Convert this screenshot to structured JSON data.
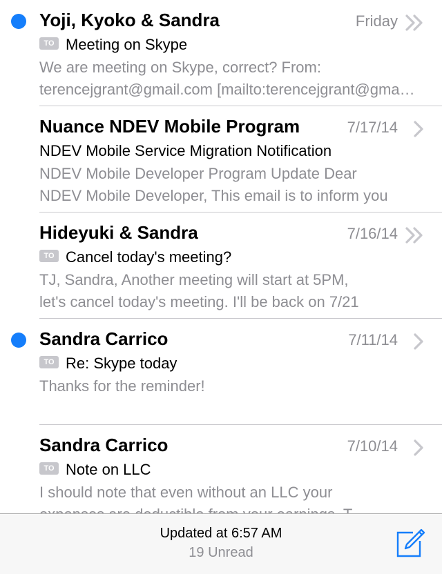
{
  "colors": {
    "unread_dot": "#157efb",
    "secondary_text": "#8e8e93",
    "to_badge": "#c7c7cc",
    "toolbar_bg": "#f7f7f7",
    "accent": "#157efb"
  },
  "messages": [
    {
      "sender": "Yoji, Kyoko & Sandra",
      "date": "Friday",
      "unread": true,
      "to_badge": "TO",
      "subject": "Meeting on Skype",
      "preview_line1": "We are meeting on Skype, correct? From:",
      "preview_line2": "terencejgrant@gmail.com [mailto:terencejgrant@gmail.com]",
      "thread_icon": "double-chevron-icon"
    },
    {
      "sender": "Nuance NDEV Mobile Program",
      "date": "7/17/14",
      "unread": false,
      "to_badge": "",
      "subject": "NDEV Mobile Service Migration Notification",
      "preview_line1": "NDEV Mobile Developer Program Update Dear",
      "preview_line2": "NDEV Mobile Developer, This email is to inform you",
      "thread_icon": "chevron-right-icon"
    },
    {
      "sender": "Hideyuki & Sandra",
      "date": "7/16/14",
      "unread": false,
      "to_badge": "TO",
      "subject": "Cancel today's meeting?",
      "preview_line1": "TJ, Sandra, Another meeting will start at 5PM,",
      "preview_line2": "let's cancel today's meeting. I'll be back on 7/21",
      "thread_icon": "double-chevron-icon"
    },
    {
      "sender": "Sandra Carrico",
      "date": "7/11/14",
      "unread": true,
      "to_badge": "TO",
      "subject": "Re: Skype today",
      "preview_line1": "Thanks for the reminder!",
      "preview_line2": "",
      "thread_icon": "chevron-right-icon"
    },
    {
      "sender": "Sandra Carrico",
      "date": "7/10/14",
      "unread": false,
      "to_badge": "TO",
      "subject": "Note on LLC",
      "preview_line1": "I should note that even without an LLC your",
      "preview_line2": "expenses are deductible from your earnings. T",
      "thread_icon": "chevron-right-icon"
    }
  ],
  "toolbar": {
    "updated_text": "Updated at 6:57 AM",
    "unread_text": "19 Unread",
    "compose_icon": "compose-icon"
  }
}
